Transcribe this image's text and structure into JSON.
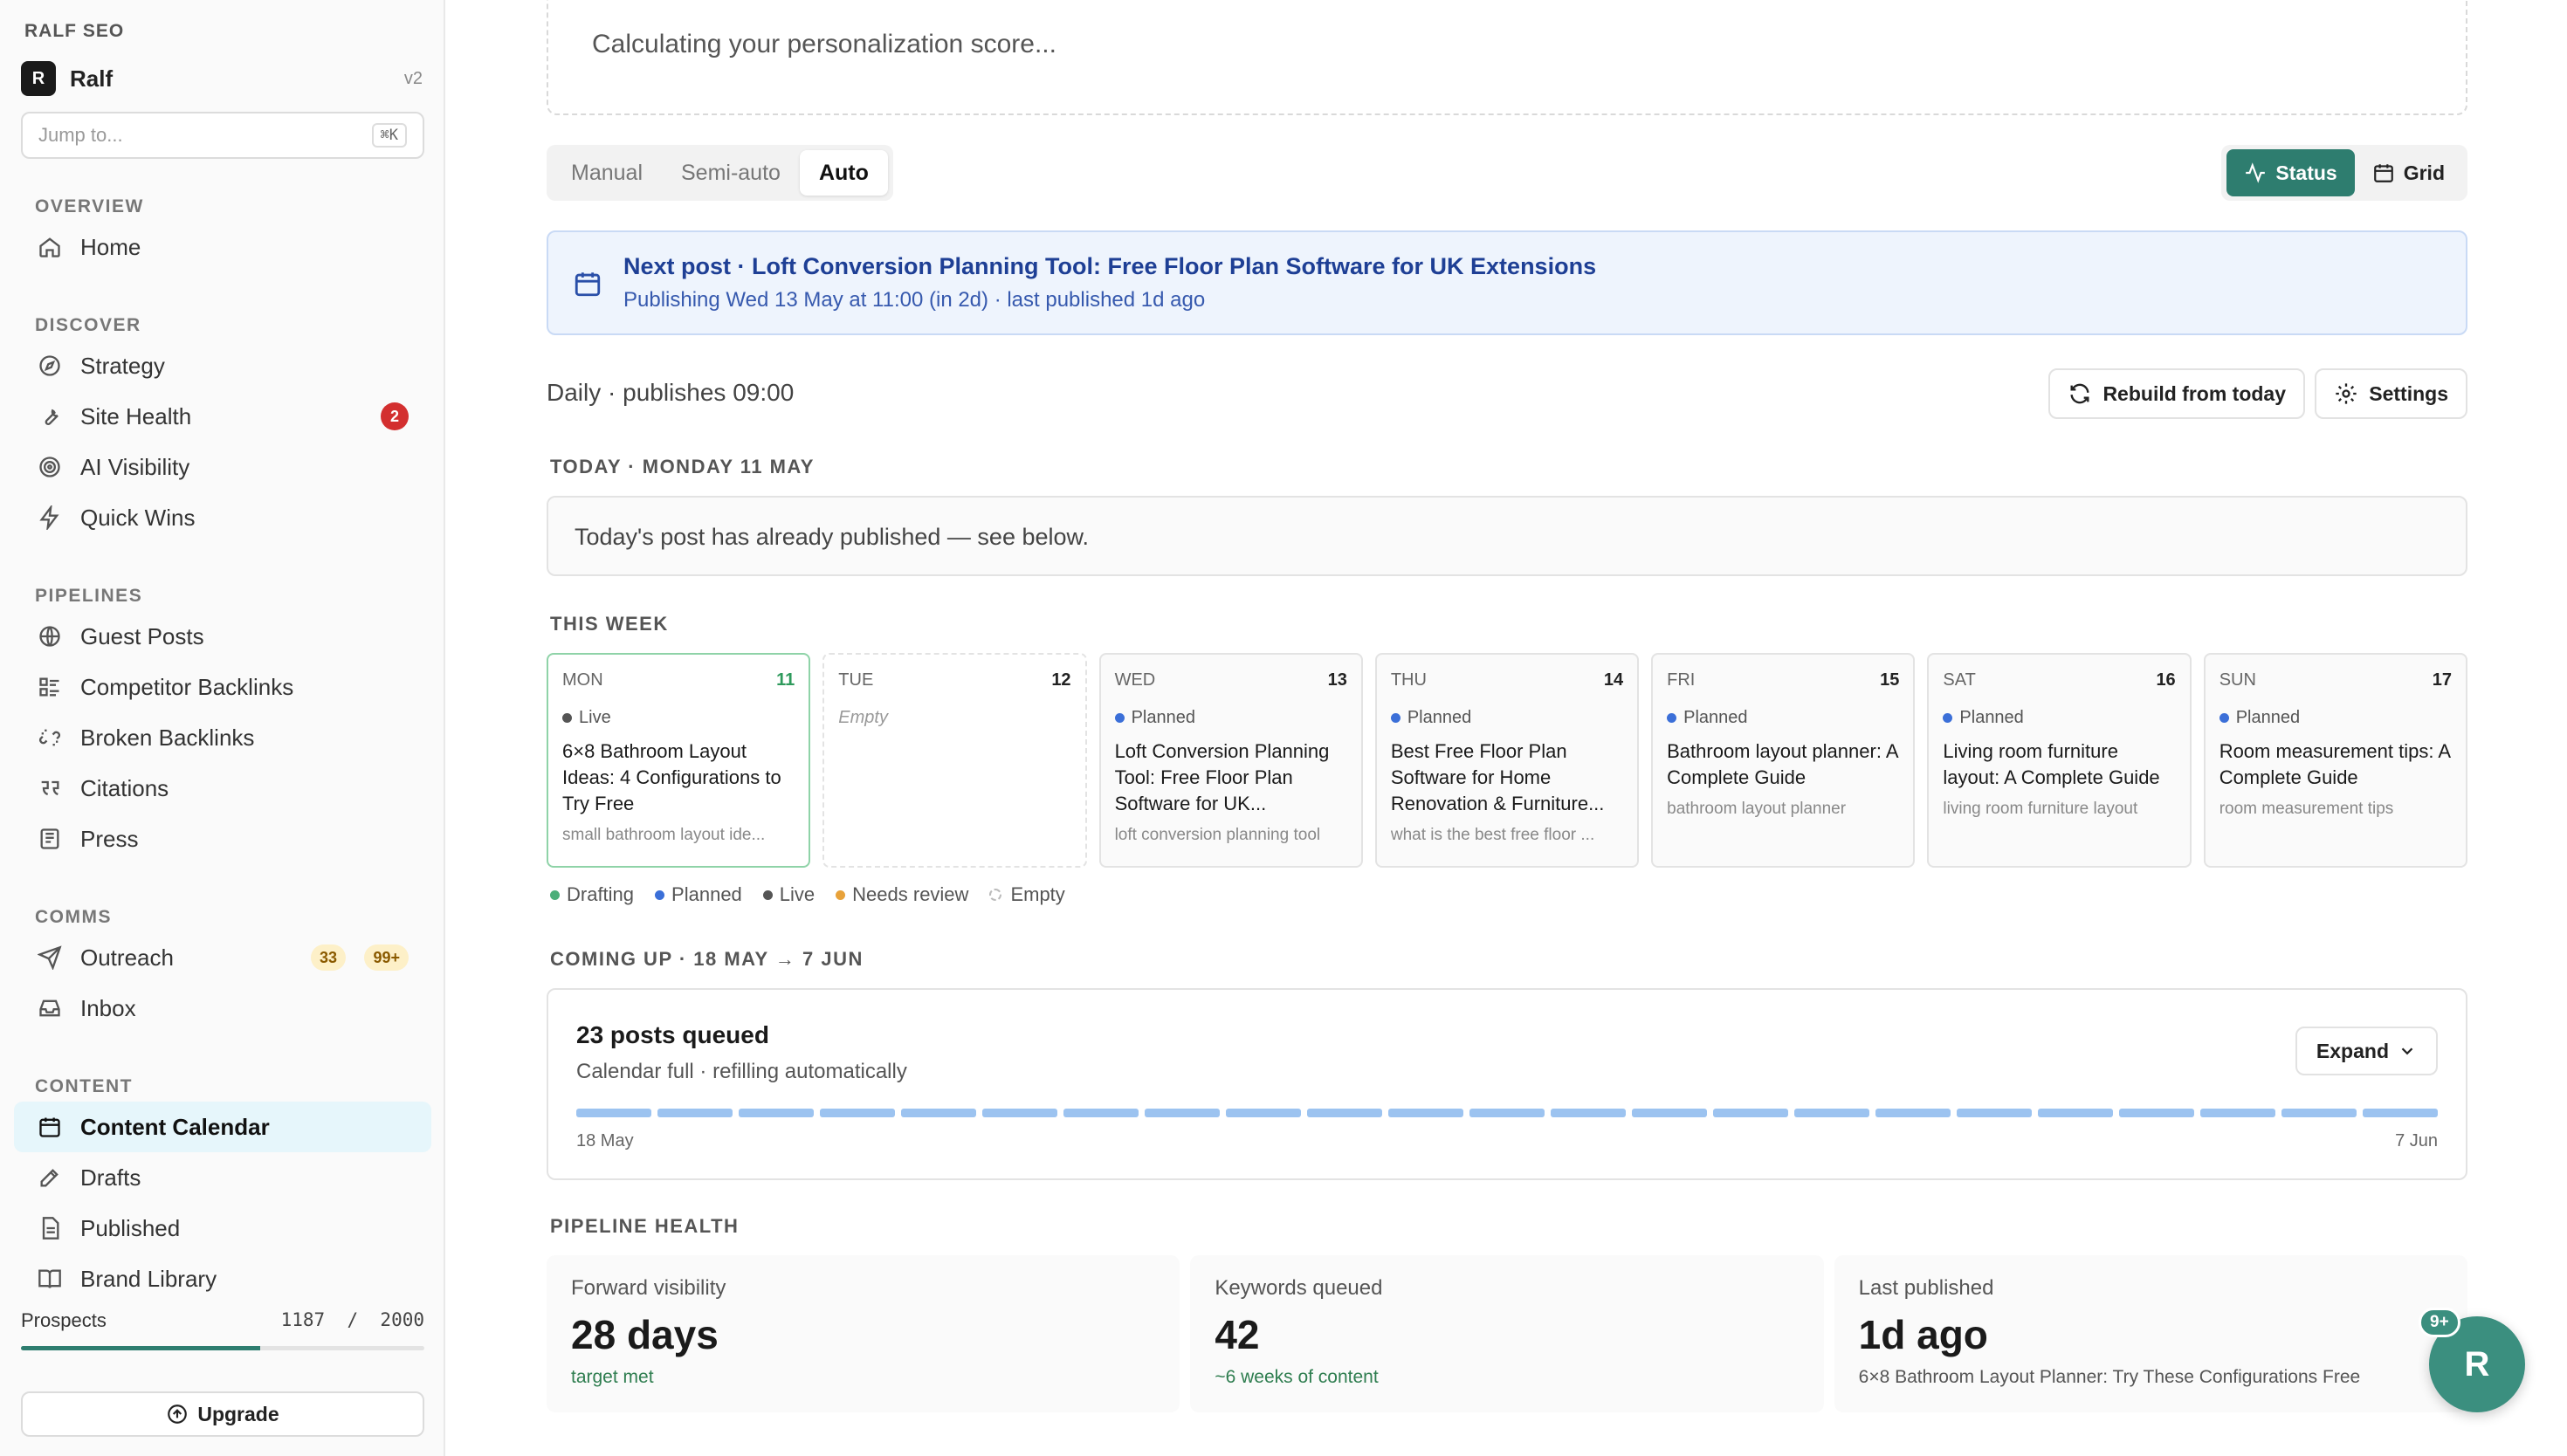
{
  "sidebar": {
    "brand": "RALF SEO",
    "workspace": {
      "logo": "R",
      "name": "Ralf",
      "version": "v2"
    },
    "jump": {
      "placeholder": "Jump to...",
      "shortcut": "⌘K"
    },
    "sections": {
      "overview": {
        "label": "OVERVIEW",
        "items": [
          {
            "label": "Home",
            "icon": "home-icon"
          }
        ]
      },
      "discover": {
        "label": "DISCOVER",
        "items": [
          {
            "label": "Strategy",
            "icon": "compass-icon"
          },
          {
            "label": "Site Health",
            "icon": "wrench-icon",
            "badge": "2"
          },
          {
            "label": "AI Visibility",
            "icon": "target-icon"
          },
          {
            "label": "Quick Wins",
            "icon": "lightning-icon"
          }
        ]
      },
      "pipelines": {
        "label": "PIPELINES",
        "items": [
          {
            "label": "Guest Posts",
            "icon": "globe-icon"
          },
          {
            "label": "Competitor Backlinks",
            "icon": "list-icon"
          },
          {
            "label": "Broken Backlinks",
            "icon": "broken-link-icon"
          },
          {
            "label": "Citations",
            "icon": "quote-icon"
          },
          {
            "label": "Press",
            "icon": "newspaper-icon"
          }
        ]
      },
      "comms": {
        "label": "COMMS",
        "items": [
          {
            "label": "Outreach",
            "icon": "send-icon",
            "badge_a": "33",
            "badge_b": "99+"
          },
          {
            "label": "Inbox",
            "icon": "inbox-icon"
          }
        ]
      },
      "content": {
        "label": "CONTENT",
        "items": [
          {
            "label": "Content Calendar",
            "icon": "calendar-icon"
          },
          {
            "label": "Drafts",
            "icon": "pen-icon"
          },
          {
            "label": "Published",
            "icon": "document-icon"
          },
          {
            "label": "Brand Library",
            "icon": "book-icon"
          }
        ]
      }
    },
    "prospects": {
      "label": "Prospects",
      "current": "1187",
      "separator": "/",
      "total": "2000",
      "progress": 0.5935
    },
    "upgrade_label": "Upgrade"
  },
  "main": {
    "score_text": "Calculating your personalization score...",
    "mode_tabs": [
      "Manual",
      "Semi-auto",
      "Auto"
    ],
    "active_mode": "Auto",
    "view_toggle": {
      "status": "Status",
      "grid": "Grid"
    },
    "next_post": {
      "title": "Next post · Loft Conversion Planning Tool: Free Floor Plan Software for UK Extensions",
      "subtitle": "Publishing Wed 13 May at 11:00 (in 2d) · last published 1d ago"
    },
    "cadence": "Daily · publishes 09:00",
    "rebuild_label": "Rebuild from today",
    "settings_label": "Settings",
    "today_label": "TODAY · MONDAY 11 MAY",
    "today_text": "Today's post has already published — see below.",
    "week_label": "THIS WEEK",
    "days": [
      {
        "dow": "MON",
        "num": "11",
        "status": "Live",
        "title": "6×8 Bathroom Layout Ideas: 4 Configurations to Try Free",
        "keyword": "small bathroom layout ide..."
      },
      {
        "dow": "TUE",
        "num": "12",
        "empty": "Empty"
      },
      {
        "dow": "WED",
        "num": "13",
        "status": "Planned",
        "title": "Loft Conversion Planning Tool: Free Floor Plan Software for UK...",
        "keyword": "loft conversion planning tool"
      },
      {
        "dow": "THU",
        "num": "14",
        "status": "Planned",
        "title": "Best Free Floor Plan Software for Home Renovation & Furniture...",
        "keyword": "what is the best free floor ..."
      },
      {
        "dow": "FRI",
        "num": "15",
        "status": "Planned",
        "title": "Bathroom layout planner: A Complete Guide",
        "keyword": "bathroom layout planner"
      },
      {
        "dow": "SAT",
        "num": "16",
        "status": "Planned",
        "title": "Living room furniture layout: A Complete Guide",
        "keyword": "living room furniture layout"
      },
      {
        "dow": "SUN",
        "num": "17",
        "status": "Planned",
        "title": "Room measurement tips: A Complete Guide",
        "keyword": "room measurement tips"
      }
    ],
    "legend": [
      "Drafting",
      "Planned",
      "Live",
      "Needs review",
      "Empty"
    ],
    "colors": {
      "drafting": "#4caf7a",
      "planned": "#3b6fd8",
      "live": "#555555",
      "needs_review": "#e8a23a",
      "accent": "#2e7d6f"
    },
    "coming_up_label": "COMING UP · 18 MAY → 7 JUN",
    "queue": {
      "title": "23 posts queued",
      "subtitle": "Calendar full · refilling automatically",
      "expand_label": "Expand",
      "start": "18 May",
      "end": "7 Jun"
    },
    "pipeline_label": "PIPELINE HEALTH",
    "stats": [
      {
        "label": "Forward visibility",
        "value": "28 days",
        "note": "target met"
      },
      {
        "label": "Keywords queued",
        "value": "42",
        "note": "~6 weeks of content"
      },
      {
        "label": "Last published",
        "value": "1d ago",
        "note": "6×8 Bathroom Layout Planner: Try These Configurations Free"
      }
    ],
    "fab": {
      "letter": "R",
      "badge": "9+"
    }
  }
}
